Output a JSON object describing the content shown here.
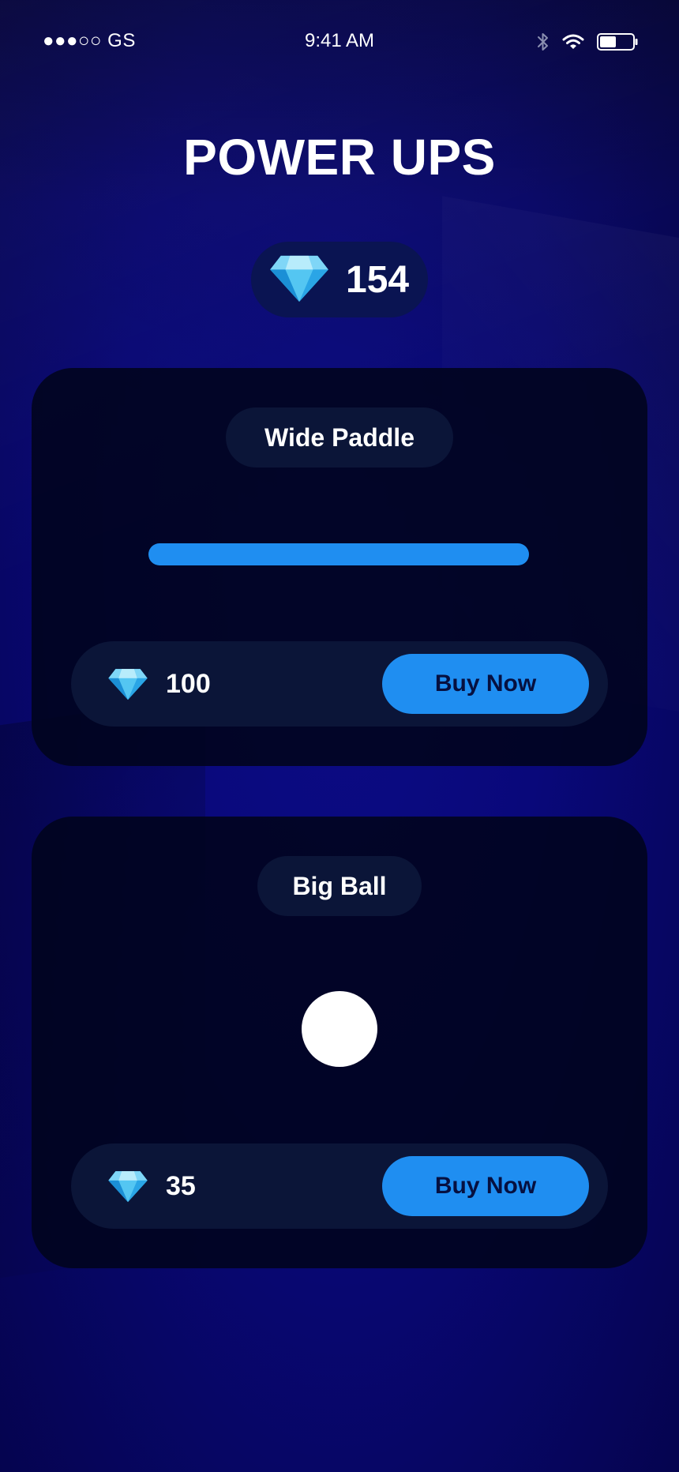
{
  "status_bar": {
    "carrier": "●●●○○ GS",
    "time": "9:41 AM",
    "icons": [
      "bluetooth-icon",
      "wifi-icon",
      "battery-icon"
    ]
  },
  "title": "POWER UPS",
  "balance": {
    "icon": "gem-icon",
    "value": "154"
  },
  "power_ups": [
    {
      "name": "Wide Paddle",
      "preview": "paddle",
      "price": "100",
      "price_icon": "gem-icon",
      "button_label": "Buy Now"
    },
    {
      "name": "Big Ball",
      "preview": "ball",
      "price": "35",
      "price_icon": "gem-icon",
      "button_label": "Buy Now"
    }
  ],
  "colors": {
    "background": "#0a0870",
    "card": "#01041e",
    "pill": "#0b1538",
    "accent": "#1f8ef1",
    "gem_light": "#7fd6f7",
    "gem_mid": "#36b6ee",
    "gem_dark": "#1b8fd6"
  }
}
